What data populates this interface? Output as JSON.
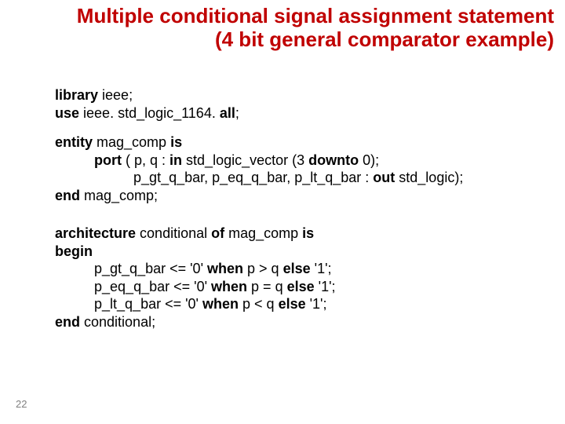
{
  "title": {
    "line1": "Multiple conditional signal assignment statement",
    "line2": "(4 bit general comparator example)"
  },
  "kw": {
    "library": "library",
    "use": "use",
    "all": "all",
    "entity": "entity",
    "is": "is",
    "port": "port",
    "in": "in",
    "downto": "downto",
    "out": "out",
    "end": "end",
    "architecture": "architecture",
    "of": "of",
    "begin": "begin",
    "when": "when",
    "else": "else"
  },
  "txt": {
    "ieee_semi": " ieee;",
    "std_logic_pkg": " ieee. std_logic_1164. ",
    "semi": ";",
    "entity_name": " mag_comp ",
    "port_open": " ( p, q : ",
    "slv_decl": " std_logic_vector (3 ",
    "zero_close": " 0);",
    "out_sigs": "p_gt_q_bar, p_eq_q_bar, p_lt_q_bar : ",
    "sl_close": " std_logic);",
    "end_entity": " mag_comp;",
    "arch_name": " conditional ",
    "arch_mid": " mag_comp ",
    "gt_left": "p_gt_q_bar <= '0' ",
    "gt_mid": " p > q ",
    "eq_left": "p_eq_q_bar <= '0' ",
    "eq_mid": " p = q ",
    "lt_left": "p_lt_q_bar <= '0' ",
    "lt_mid": " p < q ",
    "else_val": " '1';",
    "end_arch": " conditional;"
  },
  "page_number": "22"
}
